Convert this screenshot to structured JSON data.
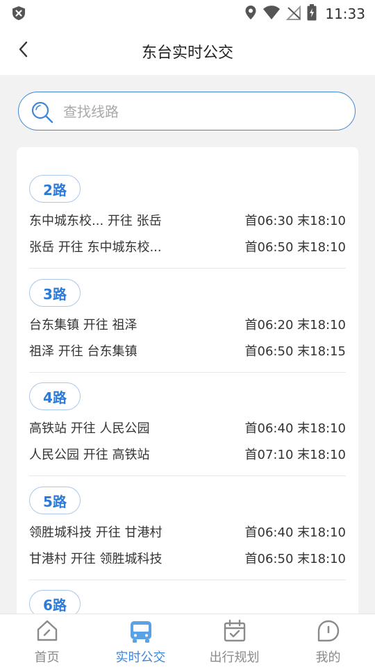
{
  "status_bar": {
    "time": "11:33"
  },
  "header": {
    "title": "东台实时公交"
  },
  "search": {
    "placeholder": "查找线路"
  },
  "routes": [
    {
      "name": "2路",
      "rows": [
        {
          "direction": "东中城东校... 开往 张岳",
          "times": "首06:30 末18:10"
        },
        {
          "direction": "张岳 开往 东中城东校...",
          "times": "首06:50 末18:10"
        }
      ]
    },
    {
      "name": "3路",
      "rows": [
        {
          "direction": "台东集镇 开往 祖泽",
          "times": "首06:20 末18:10"
        },
        {
          "direction": "祖泽 开往 台东集镇",
          "times": "首06:50 末18:15"
        }
      ]
    },
    {
      "name": "4路",
      "rows": [
        {
          "direction": "高铁站 开往 人民公园",
          "times": "首06:40 末18:10"
        },
        {
          "direction": "人民公园 开往 高铁站",
          "times": "首07:10 末18:10"
        }
      ]
    },
    {
      "name": "5路",
      "rows": [
        {
          "direction": "领胜城科技 开往 甘港村",
          "times": "首06:40 末18:10"
        },
        {
          "direction": "甘港村 开往 领胜城科技",
          "times": "首06:50 末18:10"
        }
      ]
    },
    {
      "name": "6路",
      "rows": []
    }
  ],
  "tabs": [
    {
      "label": "首页",
      "icon": "home-icon",
      "active": false
    },
    {
      "label": "实时公交",
      "icon": "bus-icon",
      "active": true
    },
    {
      "label": "出行规划",
      "icon": "calendar-check-icon",
      "active": false
    },
    {
      "label": "我的",
      "icon": "profile-icon",
      "active": false
    }
  ],
  "colors": {
    "accent": "#3f86d6",
    "badge_text": "#2c7ad6",
    "badge_border": "#a9c7ea",
    "inactive_tab": "#8a8a8a"
  }
}
